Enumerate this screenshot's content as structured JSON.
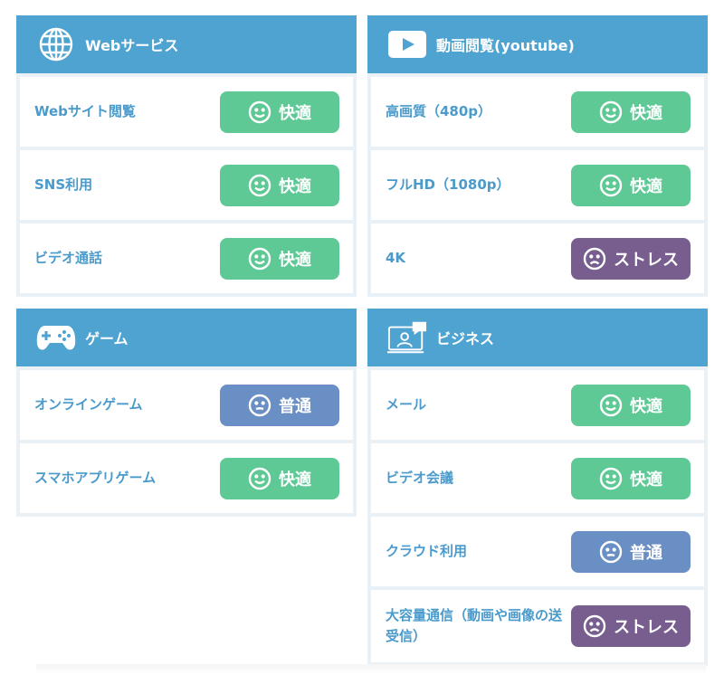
{
  "cards": [
    {
      "id": "web",
      "title": "Webサービス",
      "icon": "globe-icon",
      "rows": [
        {
          "label": "Webサイト閲覧",
          "status": "good",
          "status_label": "快適"
        },
        {
          "label": "SNS利用",
          "status": "good",
          "status_label": "快適"
        },
        {
          "label": "ビデオ通話",
          "status": "good",
          "status_label": "快適"
        }
      ]
    },
    {
      "id": "video",
      "title": "動画閲覧(youtube)",
      "icon": "play-icon",
      "rows": [
        {
          "label": "高画質（480p）",
          "status": "good",
          "status_label": "快適"
        },
        {
          "label": "フルHD（1080p）",
          "status": "good",
          "status_label": "快適"
        },
        {
          "label": "4K",
          "status": "stress",
          "status_label": "ストレス"
        }
      ]
    },
    {
      "id": "game",
      "title": "ゲーム",
      "icon": "gamepad-icon",
      "rows": [
        {
          "label": "オンラインゲーム",
          "status": "normal",
          "status_label": "普通"
        },
        {
          "label": "スマホアプリゲーム",
          "status": "good",
          "status_label": "快適"
        }
      ]
    },
    {
      "id": "business",
      "title": "ビジネス",
      "icon": "monitor-person-icon",
      "rows": [
        {
          "label": "メール",
          "status": "good",
          "status_label": "快適"
        },
        {
          "label": "ビデオ会議",
          "status": "good",
          "status_label": "快適"
        },
        {
          "label": "クラウド利用",
          "status": "normal",
          "status_label": "普通"
        },
        {
          "label": "大容量通信（動画や画像の送受信）",
          "status": "stress",
          "status_label": "ストレス"
        }
      ]
    }
  ],
  "colors": {
    "header": "#4fa3d1",
    "label": "#4a9bcc",
    "good": "#5fc996",
    "normal": "#6a8fc4",
    "stress": "#775e8e"
  }
}
